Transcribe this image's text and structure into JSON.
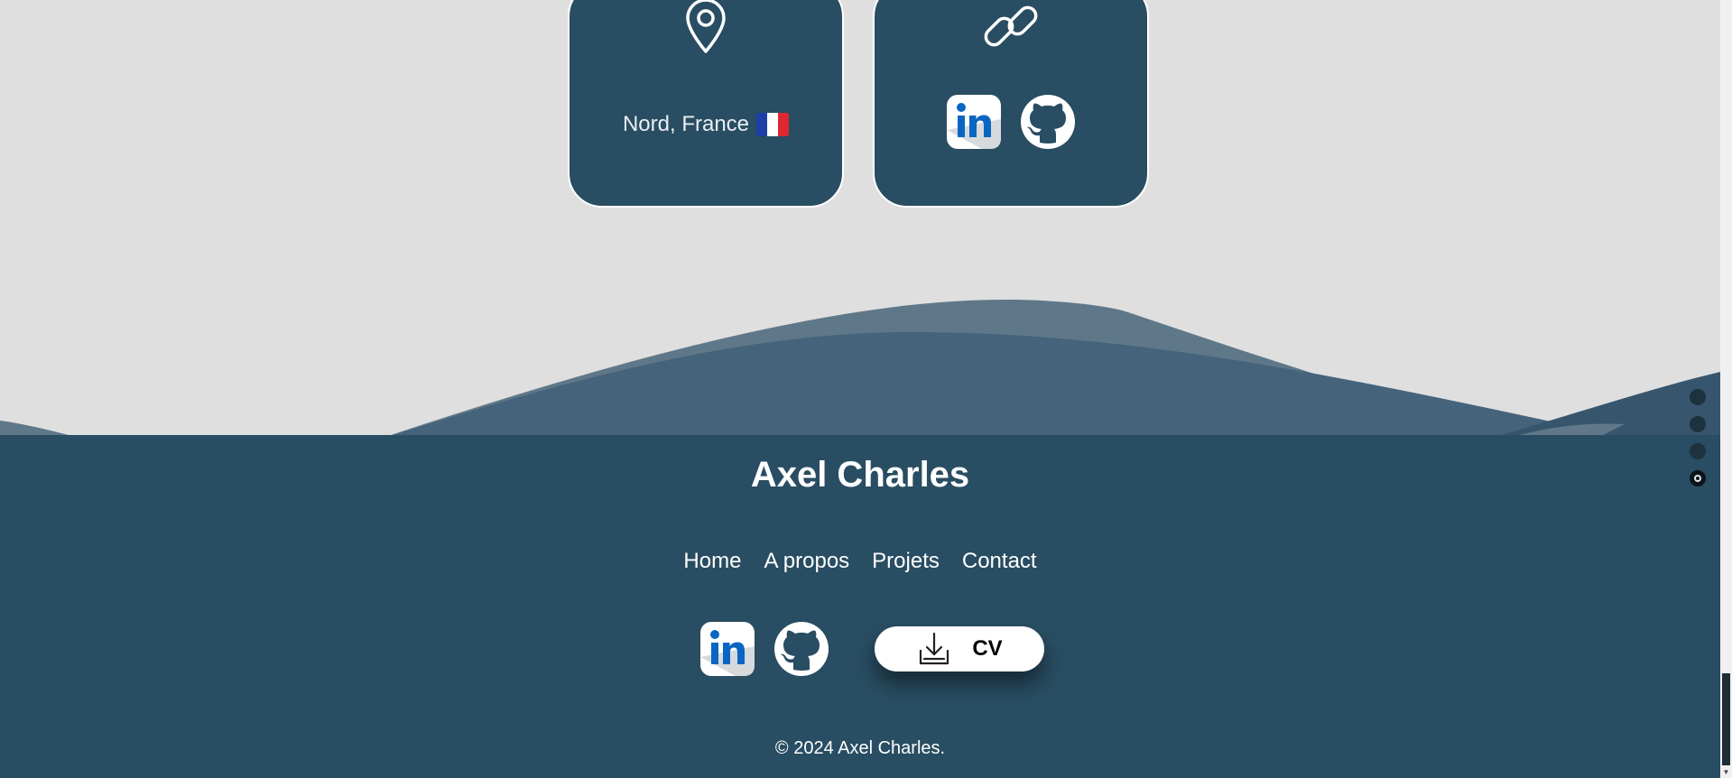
{
  "location_card": {
    "icon": "map-pin-icon",
    "text": "Nord, France",
    "flag": {
      "icon": "france-flag-icon",
      "colors": [
        "#1f3fa8",
        "#ffffff",
        "#e0272f"
      ]
    }
  },
  "links_card": {
    "icon": "link-chain-icon",
    "items": [
      {
        "icon": "linkedin-icon"
      },
      {
        "icon": "github-icon"
      }
    ]
  },
  "footer": {
    "title": "Axel Charles",
    "nav": [
      {
        "label": "Home"
      },
      {
        "label": "A propos"
      },
      {
        "label": "Projets"
      },
      {
        "label": "Contact"
      }
    ],
    "social": [
      {
        "icon": "linkedin-icon"
      },
      {
        "icon": "github-icon"
      }
    ],
    "cv_button": {
      "icon": "download-icon",
      "label": "CV"
    },
    "copyright": "© 2024 Axel Charles."
  },
  "section_nav": {
    "count": 4,
    "active_index": 3
  },
  "colors": {
    "background": "#dfdfdf",
    "primary": "#294d62",
    "linkedin": "#0a66c2",
    "white": "#ffffff"
  }
}
